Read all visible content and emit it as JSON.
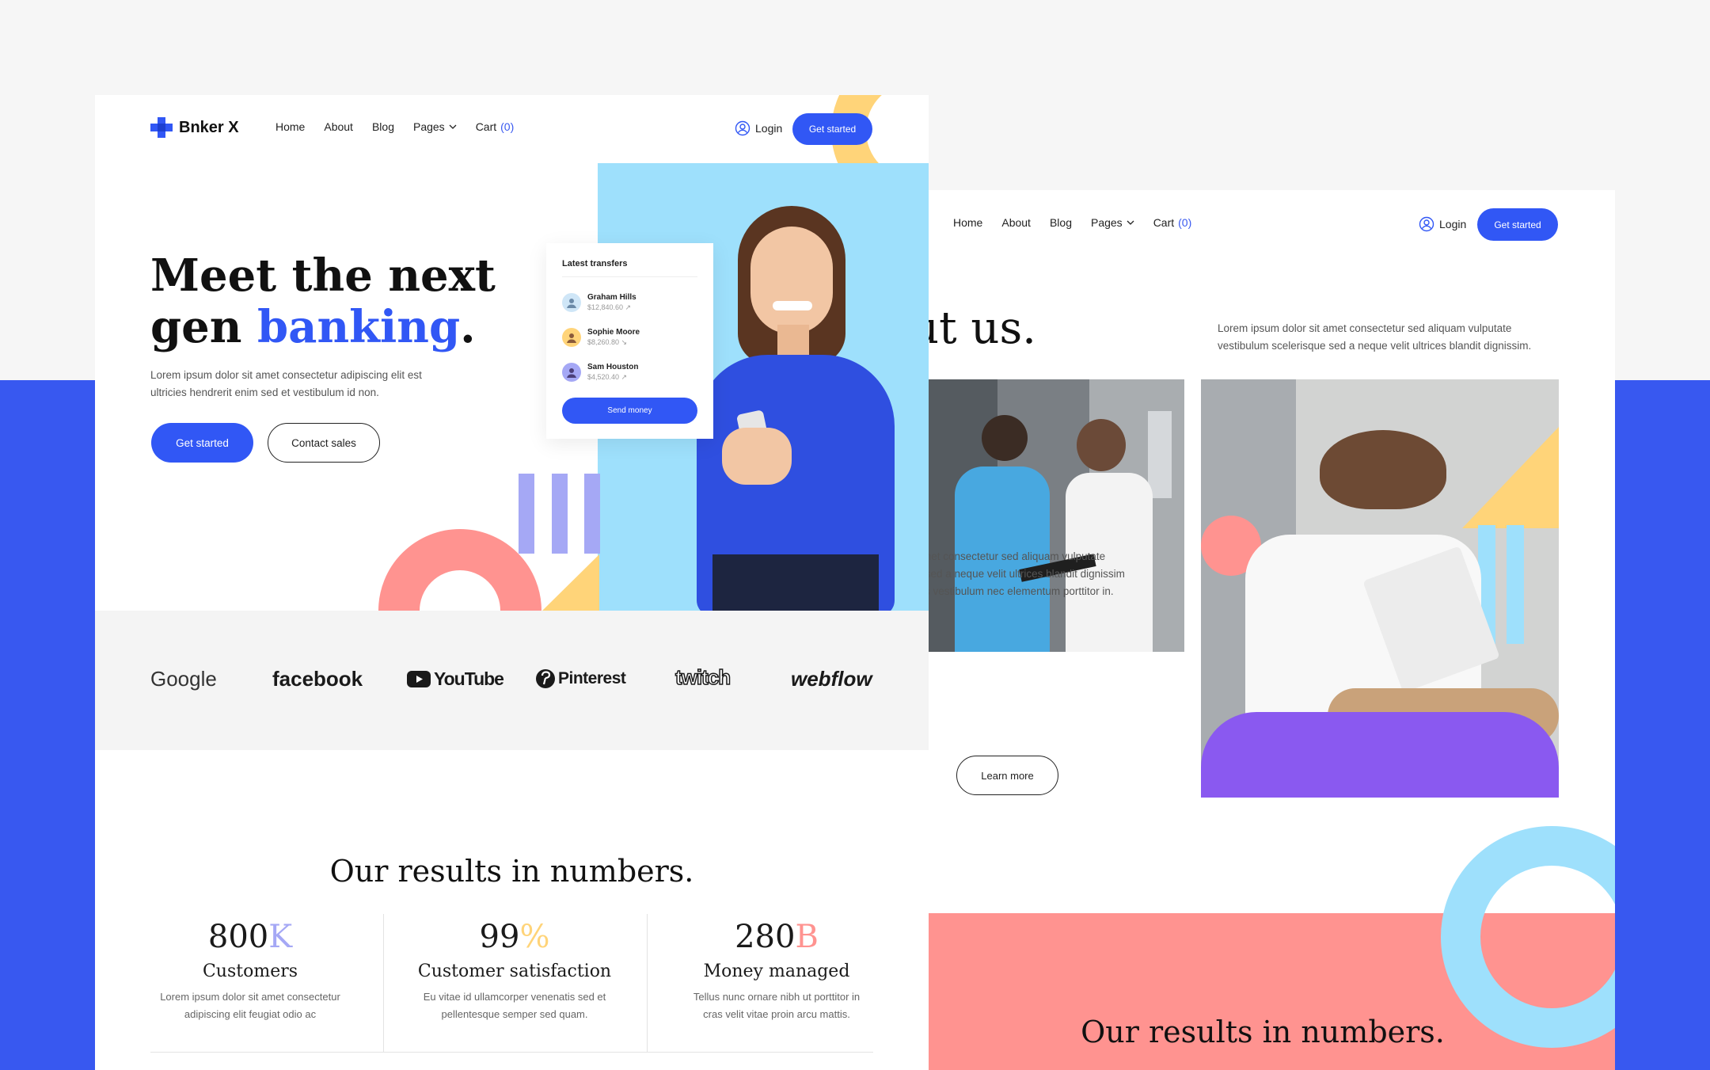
{
  "front": {
    "logo_text": "Bnker X",
    "nav": {
      "home": "Home",
      "about": "About",
      "blog": "Blog",
      "pages": "Pages",
      "cart": "Cart",
      "cart_count": "(0)",
      "login": "Login",
      "cta": "Get started"
    },
    "hero": {
      "title_line1": "Meet the next",
      "title_gen": "gen",
      "title_accent": "banking",
      "title_dot": ".",
      "subtitle_line1": "Lorem ipsum dolor sit amet consectetur adipiscing elit est",
      "subtitle_line2": "ultricies hendrerit enim sed et vestibulum id non.",
      "primary_button": "Get started",
      "secondary_button": "Contact sales"
    },
    "transfers": {
      "title": "Latest transfers",
      "items": [
        {
          "name": "Graham Hills",
          "amount": "$12,840.60 ↗"
        },
        {
          "name": "Sophie Moore",
          "amount": "$8,260.80 ↘"
        },
        {
          "name": "Sam Houston",
          "amount": "$4,520.40 ↗"
        }
      ],
      "button": "Send money"
    },
    "brands": [
      "Google",
      "facebook",
      "YouTube",
      "Pinterest",
      "twitch",
      "webflow"
    ],
    "results": {
      "title": "Our results in numbers.",
      "stats": [
        {
          "number": "800",
          "suffix": "K",
          "title": "Customers",
          "desc1": "Lorem ipsum dolor sit amet consectetur",
          "desc2": "adipiscing elit feugiat odio ac"
        },
        {
          "number": "99",
          "suffix": "%",
          "title": "Customer satisfaction",
          "desc1": "Eu vitae id ullamcorper venenatis sed et",
          "desc2": "pellentesque semper sed quam."
        },
        {
          "number": "280",
          "suffix": "B",
          "title": "Money managed",
          "desc1": "Tellus nunc ornare nibh ut porttitor in",
          "desc2": "cras velit vitae proin arcu mattis."
        }
      ]
    }
  },
  "back": {
    "nav": {
      "home": "Home",
      "about": "About",
      "blog": "Blog",
      "pages": "Pages",
      "cart": "Cart",
      "cart_count": "(0)",
      "login": "Login",
      "cta": "Get started"
    },
    "heading_fragment": "ut us.",
    "intro_line1": "Lorem ipsum dolor sit amet consectetur sed aliquam vulputate",
    "intro_line2": "vestibulum scelerisque sed a neque velit ultrices blandit dignissim.",
    "body_line1": "t amet consectetur sed aliquam vulputate",
    "body_line2": "ue sed a neque velit ultrices blandit dignissim",
    "body_line3": "ibus vestibulum nec elementum porttitor in.",
    "learn_more": "Learn more",
    "results_title": "Our results in numbers."
  },
  "colors": {
    "brand_blue": "#3157f5",
    "sky": "#9ee0fc",
    "coral": "#ff9390",
    "yellow": "#ffd479",
    "lavender": "#a5a8f5"
  }
}
